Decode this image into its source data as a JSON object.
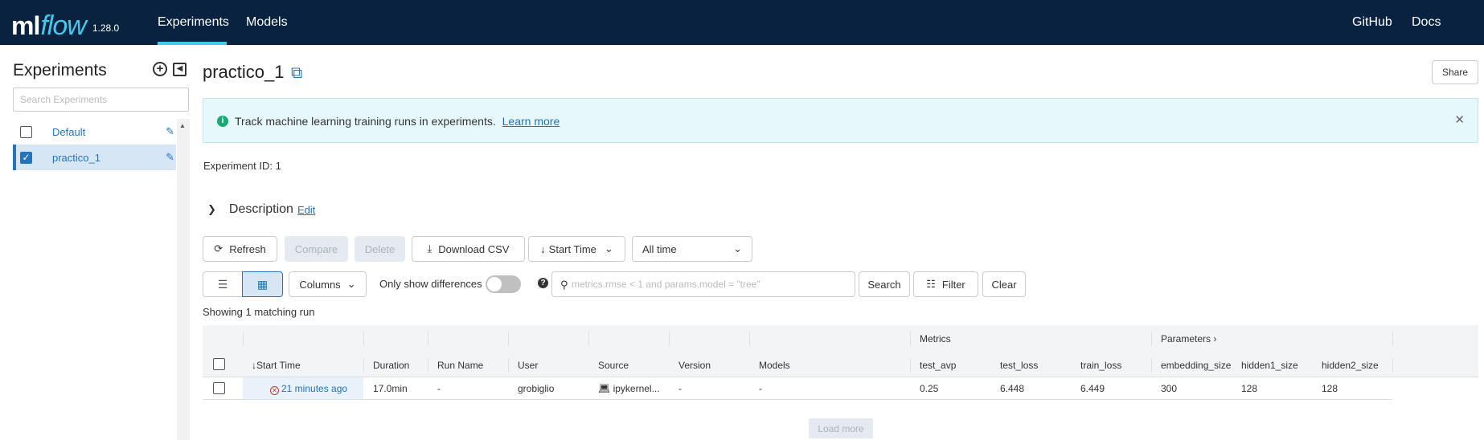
{
  "header": {
    "logo_ml": "ml",
    "logo_flow": "flow",
    "version": "1.28.0",
    "nav": {
      "experiments": "Experiments",
      "models": "Models",
      "github": "GitHub",
      "docs": "Docs"
    },
    "accent_color": "#43c9ed",
    "background_color": "#082240"
  },
  "sidebar": {
    "title": "Experiments",
    "search_placeholder": "Search Experiments",
    "items": [
      {
        "label": "Default",
        "checked": false
      },
      {
        "label": "practico_1",
        "checked": true
      }
    ],
    "icons": [
      "plus-circle-icon",
      "collapse-icon",
      "pencil-icon"
    ]
  },
  "main": {
    "title": "practico_1",
    "share_label": "Share",
    "banner": {
      "text": "Track machine learning training runs in experiments.",
      "link": "Learn more"
    },
    "experiment_id_label": "Experiment ID:",
    "experiment_id": "1",
    "description_label": "Description",
    "description_edit": "Edit",
    "toolbar": {
      "refresh": "Refresh",
      "compare": "Compare",
      "delete": "Delete",
      "download_csv": "Download CSV",
      "sort": "Start Time",
      "time_range": "All time",
      "columns": "Columns",
      "only_show_differences": "Only show differences",
      "search_placeholder": "metrics.rmse < 1 and params.model = \"tree\"",
      "search": "Search",
      "filter": "Filter",
      "clear": "Clear",
      "load_more": "Load more"
    },
    "showing": "Showing 1 matching run",
    "table": {
      "group_headers": {
        "metrics": "Metrics",
        "parameters": "Parameters"
      },
      "columns": [
        "Start Time",
        "Duration",
        "Run Name",
        "User",
        "Source",
        "Version",
        "Models",
        "test_avp",
        "test_loss",
        "train_loss",
        "embedding_size",
        "hidden1_size",
        "hidden2_size"
      ],
      "rows": [
        {
          "start_time": "21 minutes ago",
          "duration": "17.0min",
          "run_name": "-",
          "user": "grobiglio",
          "source": "ipykernel...",
          "version": "-",
          "models": "-",
          "test_avp": "0.25",
          "test_loss": "6.448",
          "train_loss": "6.449",
          "embedding_size": "300",
          "hidden1_size": "128",
          "hidden2_size": "128"
        }
      ]
    }
  }
}
